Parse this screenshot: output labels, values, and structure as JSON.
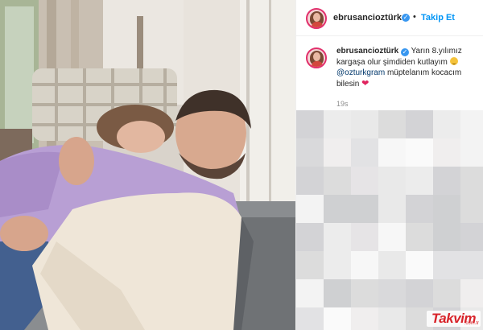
{
  "post": {
    "username": "ebrusancioztürk",
    "follow_label": "Takip Et",
    "separator": "•",
    "caption": {
      "username": "ebrusancioztürk",
      "line1": " Yarın 8.yılımız kargaşa olur şimdiden kutlayım",
      "mention": "@ozturkgram",
      "line2": " müptelanım kocacım bilesin"
    },
    "time": "19s"
  },
  "watermark": {
    "text": "Takvim",
    "suffix": ".com.tr"
  },
  "colors": {
    "verified": "#3897f0",
    "follow": "#0095f6",
    "heart": "#e0245e",
    "watermark": "#d8232a"
  },
  "icons": [
    "verified-badge-icon",
    "heart-emoji-icon",
    "smile-emoji-icon"
  ]
}
